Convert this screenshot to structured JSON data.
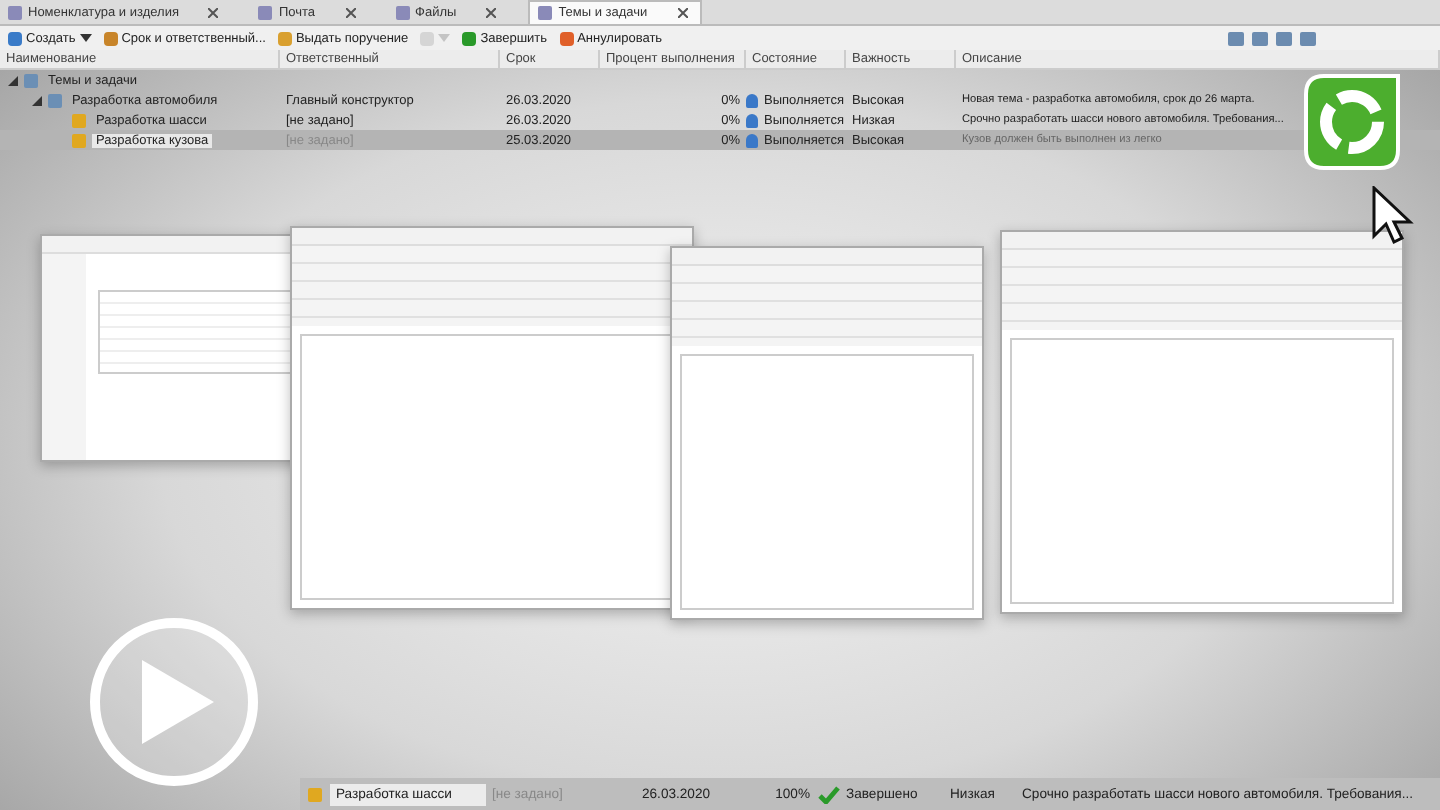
{
  "tabs": [
    {
      "label": "Номенклатура и изделия",
      "selected": false
    },
    {
      "label": "Почта",
      "selected": false
    },
    {
      "label": "Файлы",
      "selected": false
    },
    {
      "label": "Темы и задачи",
      "selected": true
    }
  ],
  "toolbar": [
    {
      "label": "Создать",
      "kind": "dropdown"
    },
    {
      "label": "Срок и ответственный...",
      "kind": "button"
    },
    {
      "label": "Выдать поручение",
      "kind": "button"
    },
    {
      "kind": "icon-dropdown"
    },
    {
      "label": "Завершить",
      "kind": "button"
    },
    {
      "label": "Аннулировать",
      "kind": "button"
    }
  ],
  "columns": [
    "Наименование",
    "Ответственный",
    "Срок",
    "Процент выполнения",
    "Состояние",
    "Важность",
    "Описание"
  ],
  "tree": [
    {
      "name": "Темы и задачи",
      "kind": "folder",
      "expanded": true,
      "selected": false,
      "children": [
        {
          "name": "Разработка автомобиля",
          "kind": "folder",
          "expanded": true,
          "selected": false,
          "responsible": "Главный конструктор",
          "due": "26.03.2020",
          "percent": "0%",
          "state": {
            "label": "Выполняется",
            "kind": "in_progress"
          },
          "importance": "Высокая",
          "description": "Новая тема - разработка автомобиля, срок до 26 марта.",
          "children": [
            {
              "name": "Разработка шасси",
              "kind": "task",
              "selected": false,
              "responsible": "[не задано]",
              "due": "26.03.2020",
              "percent": "0%",
              "state": {
                "label": "Выполняется",
                "kind": "in_progress"
              },
              "importance": "Низкая",
              "description": "Срочно разработать шасси нового автомобиля. Требования..."
            },
            {
              "name": "Разработка кузова",
              "kind": "task",
              "selected": true,
              "responsible": "[не задано]",
              "due": "25.03.2020",
              "percent": "0%",
              "state": {
                "label": "Выполняется",
                "kind": "in_progress"
              },
              "importance": "Высокая",
              "description": "Кузов должен быть выполнен из легко"
            }
          ]
        }
      ]
    }
  ],
  "highlight_row": {
    "name": "Разработка шасси",
    "responsible": "[не задано]",
    "due": "26.03.2020",
    "percent": "100%",
    "state": {
      "label": "Завершено",
      "kind": "done"
    },
    "importance": "Низкая",
    "description": "Срочно разработать шасси нового автомобиля. Требования..."
  }
}
